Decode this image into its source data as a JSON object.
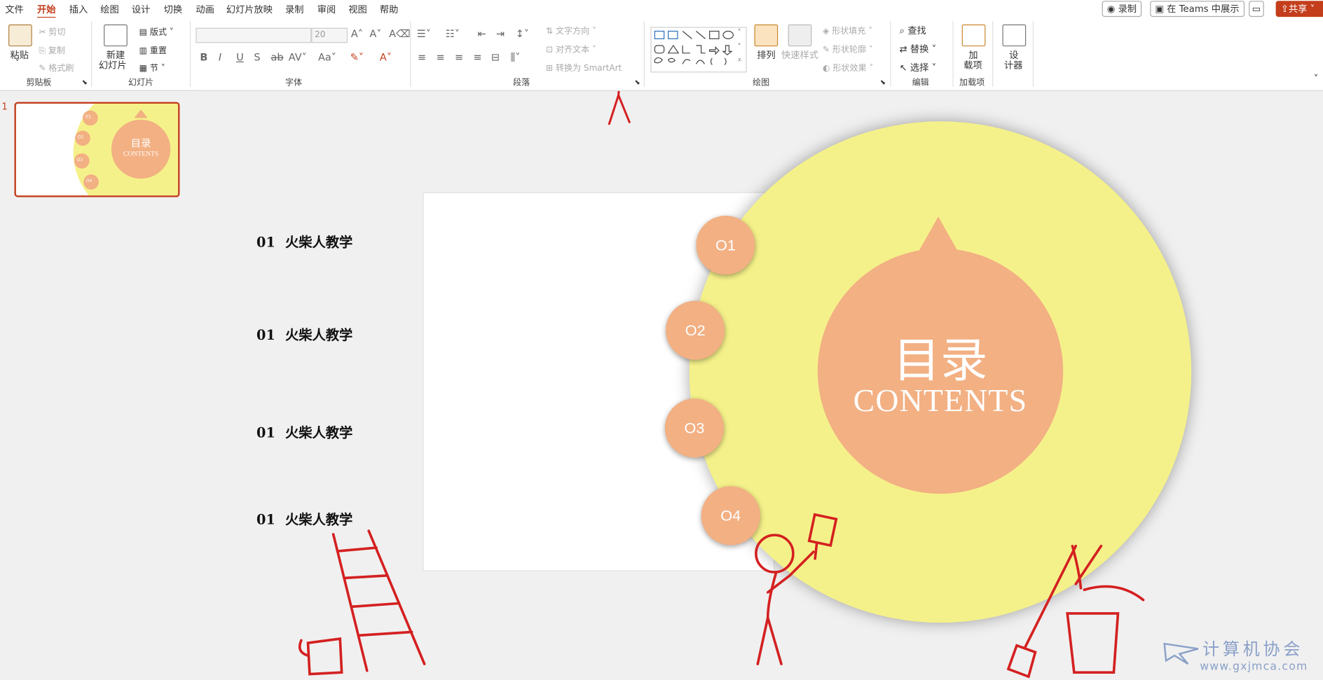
{
  "menu": [
    "文件",
    "开始",
    "插入",
    "绘图",
    "设计",
    "切换",
    "动画",
    "幻灯片放映",
    "录制",
    "审阅",
    "视图",
    "帮助"
  ],
  "menu_active": "开始",
  "top_buttons": {
    "record": "录制",
    "teams": "在 Teams 中展示",
    "share": "共享"
  },
  "ribbon": {
    "clipboard": {
      "paste": "粘贴",
      "cut": "剪切",
      "copy": "复制",
      "format_painter": "格式刷",
      "group": "剪贴板"
    },
    "slides": {
      "new_slide_1": "新建",
      "new_slide_2": "幻灯片",
      "layout": "版式",
      "reset": "重置",
      "section": "节",
      "group": "幻灯片"
    },
    "font": {
      "size": "20",
      "group": "字体"
    },
    "paragraph": {
      "text_direction": "文字方向",
      "align_text": "对齐文本",
      "smartart": "转换为 SmartArt",
      "group": "段落"
    },
    "drawing": {
      "arrange": "排列",
      "quick_styles": "快速样式",
      "fill": "形状填充",
      "outline": "形状轮廓",
      "effects": "形状效果",
      "group": "绘图"
    },
    "editing": {
      "find": "查找",
      "replace": "替换",
      "select": "选择",
      "group": "编辑"
    },
    "addins": {
      "label_1": "加",
      "label_2": "载项",
      "group": "加载项"
    },
    "designer": {
      "label_1": "设",
      "label_2": "计器"
    }
  },
  "thumbnail": {
    "number": "1",
    "title_cn": "目录",
    "title_en": "CONTENTS",
    "nums": [
      "O1",
      "O2",
      "O3",
      "O4"
    ]
  },
  "slide": {
    "items": [
      {
        "num": "01",
        "text": "火柴人教学"
      },
      {
        "num": "01",
        "text": "火柴人教学"
      },
      {
        "num": "01",
        "text": "火柴人教学"
      },
      {
        "num": "01",
        "text": "火柴人教学"
      }
    ],
    "title_cn": "目录",
    "title_en": "CONTENTS",
    "circle_nums": [
      "O1",
      "O2",
      "O3",
      "O4"
    ]
  },
  "watermark": {
    "text": "计算机协会",
    "url": "www.gxjmca.com"
  },
  "colors": {
    "accent": "#c43e1c",
    "yellow": "#f5f18a",
    "peach": "#f2b083",
    "doodle": "#d42020"
  }
}
